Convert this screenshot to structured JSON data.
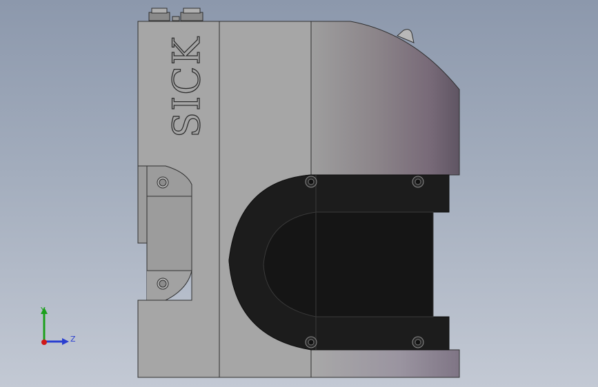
{
  "model": {
    "brand_engraving": "SICK",
    "colors": {
      "housing_light": "#a6a6a6",
      "housing_mid": "#8f8f8f",
      "cover_dark": "#1a1a1a",
      "edge": "#2e2e2e",
      "cap_shade": "#6c5f6e"
    }
  },
  "triad": {
    "y_label": "Y",
    "z_label": "Z",
    "colors": {
      "y": "#1ca01c",
      "z": "#2a3fd0",
      "x": "#d01818"
    }
  }
}
